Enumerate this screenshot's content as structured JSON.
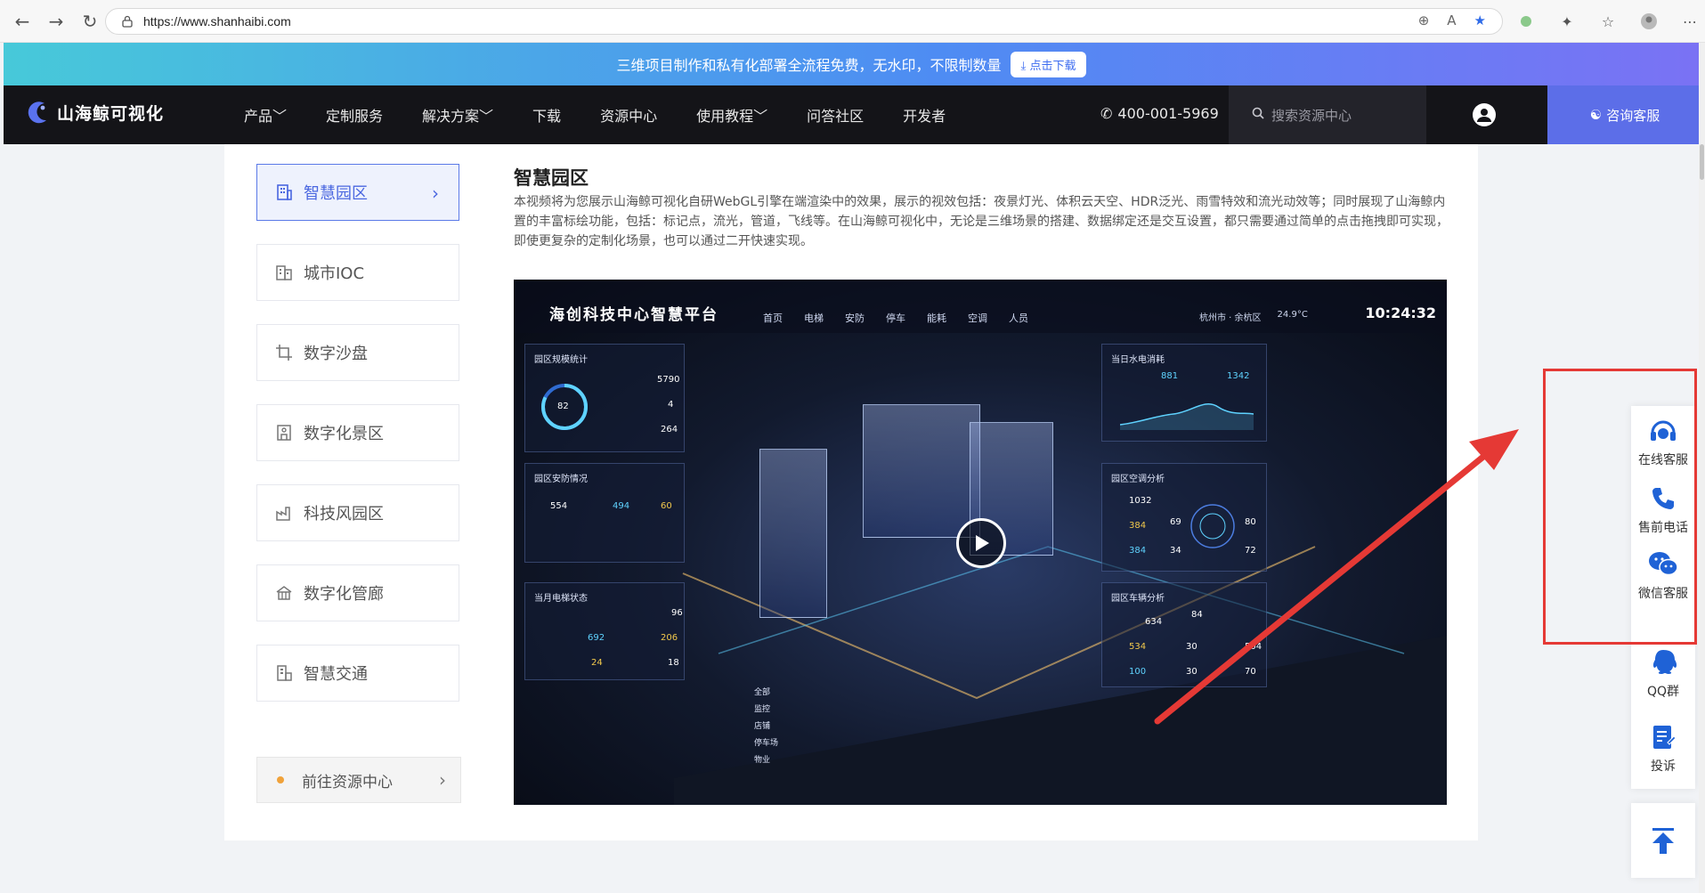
{
  "browser": {
    "url": "https://www.shanhaibi.com"
  },
  "promo": {
    "text": "三维项目制作和私有化部署全流程免费，无水印，不限制数量",
    "button": "点击下载"
  },
  "header": {
    "logo_text": "山海鲸可视化",
    "menu": [
      {
        "label": "产品",
        "has_dropdown": true
      },
      {
        "label": "定制服务",
        "has_dropdown": false
      },
      {
        "label": "解决方案",
        "has_dropdown": true
      },
      {
        "label": "下载",
        "has_dropdown": false
      },
      {
        "label": "资源中心",
        "has_dropdown": false
      },
      {
        "label": "使用教程",
        "has_dropdown": true
      },
      {
        "label": "问答社区",
        "has_dropdown": false
      },
      {
        "label": "开发者",
        "has_dropdown": false
      }
    ],
    "menu_display": [
      "产品﹀",
      "定制服务",
      "解决方案﹀",
      "下载",
      "资源中心",
      "使用教程﹀",
      "问答社区",
      "开发者"
    ],
    "phone": "400-001-5969",
    "search_placeholder": "搜索资源中心",
    "consult_label": "咨询客服"
  },
  "sidebar": {
    "items": [
      {
        "label": "智慧园区",
        "active": true,
        "icon": "building-icon"
      },
      {
        "label": "城市IOC",
        "active": false,
        "icon": "city-icon"
      },
      {
        "label": "数字沙盘",
        "active": false,
        "icon": "crop-icon"
      },
      {
        "label": "数字化景区",
        "active": false,
        "icon": "scenic-icon"
      },
      {
        "label": "科技风园区",
        "active": false,
        "icon": "factory-icon"
      },
      {
        "label": "数字化管廊",
        "active": false,
        "icon": "pipe-icon"
      },
      {
        "label": "智慧交通",
        "active": false,
        "icon": "traffic-icon"
      }
    ],
    "resource_link": "前往资源中心"
  },
  "article": {
    "title": "智慧园区",
    "description": "本视频将为您展示山海鲸可视化自研WebGL引擎在端渲染中的效果，展示的视效包括：夜景灯光、体积云天空、HDR泛光、雨雪特效和流光动效等；同时展现了山海鲸内置的丰富标绘功能，包括：标记点，流光，管道，飞线等。在山海鲸可视化中，无论是三维场景的搭建、数据绑定还是交互设置，都只需要通过简单的点击拖拽即可实现，即使更复杂的定制化场景，也可以通过二开快速实现。"
  },
  "video": {
    "dashboard_title": "海创科技中心智慧平台",
    "nav": [
      "首页",
      "电梯",
      "安防",
      "停车",
      "能耗",
      "空调",
      "人员"
    ],
    "location": "杭州市 · 余杭区",
    "temperature": "24.9°C",
    "time": "10:24:32",
    "panels": {
      "park": {
        "title": "园区规模统计",
        "rate": "82",
        "area": "5790",
        "count": "4",
        "office": "264"
      },
      "security": {
        "title": "园区安防情况",
        "a": "554",
        "b": "494",
        "c": "60"
      },
      "elevator": {
        "title": "当月电梯状态",
        "percent": "96",
        "v1": "692",
        "v2": "206",
        "v3": "24",
        "v4": "18"
      },
      "energy": {
        "title": "当日水电消耗",
        "water": "881",
        "power": "1342"
      },
      "ac": {
        "title": "园区空调分析",
        "v1": "1032",
        "v2": "384",
        "v3": "384",
        "v4": "69",
        "v5": "34",
        "v6": "80",
        "v7": "72"
      },
      "parking": {
        "title": "园区车辆分析",
        "total": "634",
        "percent": "84",
        "v1": "534",
        "v2": "30",
        "v3": "504",
        "v4": "100",
        "v5": "30",
        "v6": "70"
      }
    },
    "legend": [
      "全部",
      "监控",
      "店铺",
      "停车场",
      "物业"
    ]
  },
  "float_panel": {
    "items": [
      {
        "label": "在线客服",
        "icon": "headset-icon"
      },
      {
        "label": "售前电话",
        "icon": "phone-icon"
      },
      {
        "label": "微信客服",
        "icon": "wechat-icon"
      },
      {
        "label": "QQ群",
        "icon": "qq-icon"
      },
      {
        "label": "投诉",
        "icon": "complaint-icon"
      }
    ]
  },
  "colors": {
    "accent": "#4a67e0",
    "header_bg": "#141418",
    "annotation": "#e53935"
  }
}
